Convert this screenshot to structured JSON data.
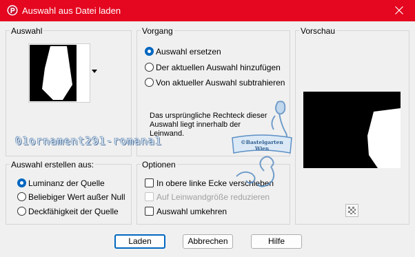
{
  "window": {
    "title": "Auswahl aus Datei laden",
    "accent_color": "#e5061f",
    "app_icon": "psp-app-icon"
  },
  "groups": {
    "auswahl": {
      "label": "Auswahl"
    },
    "vorgang": {
      "label": "Vorgang",
      "options": [
        {
          "label": "Auswahl ersetzen",
          "checked": true
        },
        {
          "label": "Der aktuellen Auswahl hinzufügen",
          "checked": false
        },
        {
          "label": "Von aktueller Auswahl subtrahieren",
          "checked": false
        }
      ],
      "info_line1": "Das ursprüngliche Rechteck dieser",
      "info_line2": "Auswahl liegt innerhalb der",
      "info_line3": "Leinwand."
    },
    "vorschau": {
      "label": "Vorschau"
    },
    "erstellen": {
      "label": "Auswahl erstellen aus:",
      "options": [
        {
          "label": "Luminanz der Quelle",
          "checked": true
        },
        {
          "label": "Beliebiger Wert außer Null",
          "checked": false
        },
        {
          "label": "Deckfähigkeit der Quelle",
          "checked": false
        }
      ]
    },
    "optionen": {
      "label": "Optionen",
      "checks": [
        {
          "label": "In obere linke Ecke verschieben",
          "checked": false,
          "enabled": true
        },
        {
          "label": "Auf Leinwandgröße reduzieren",
          "checked": false,
          "enabled": false
        },
        {
          "label": "Auswahl umkehren",
          "checked": false,
          "enabled": true
        }
      ]
    }
  },
  "watermark": {
    "text": "01ornament291-romana1",
    "stamp_line1": "©Bastelgarten",
    "stamp_line2": "Wien"
  },
  "buttons": {
    "laden": "Laden",
    "abbrechen": "Abbrechen",
    "hilfe": "Hilfe"
  }
}
